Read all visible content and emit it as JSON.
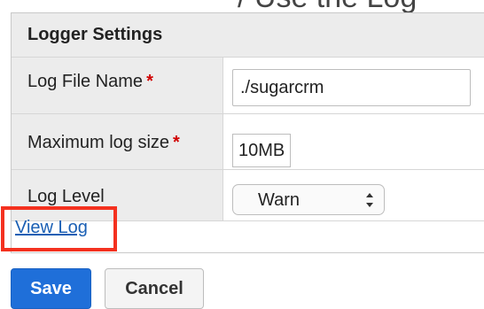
{
  "page": {
    "top_partial_text": "/ Use the Log"
  },
  "logger": {
    "title": "Logger Settings",
    "fields": [
      {
        "label": "Log File Name",
        "required": true,
        "value": "./sugarcrm"
      },
      {
        "label": "Maximum log size",
        "required": true,
        "value": "10MB"
      },
      {
        "label": "Log Level",
        "required": false,
        "value": "Warn"
      }
    ],
    "required_marker": "*",
    "view_log_link": "View Log"
  },
  "actions": {
    "save_label": "Save",
    "cancel_label": "Cancel"
  },
  "colors": {
    "accent": "#1f6fd9",
    "highlight": "#f4311f",
    "required": "#d00000",
    "link": "#1a5fb4"
  }
}
